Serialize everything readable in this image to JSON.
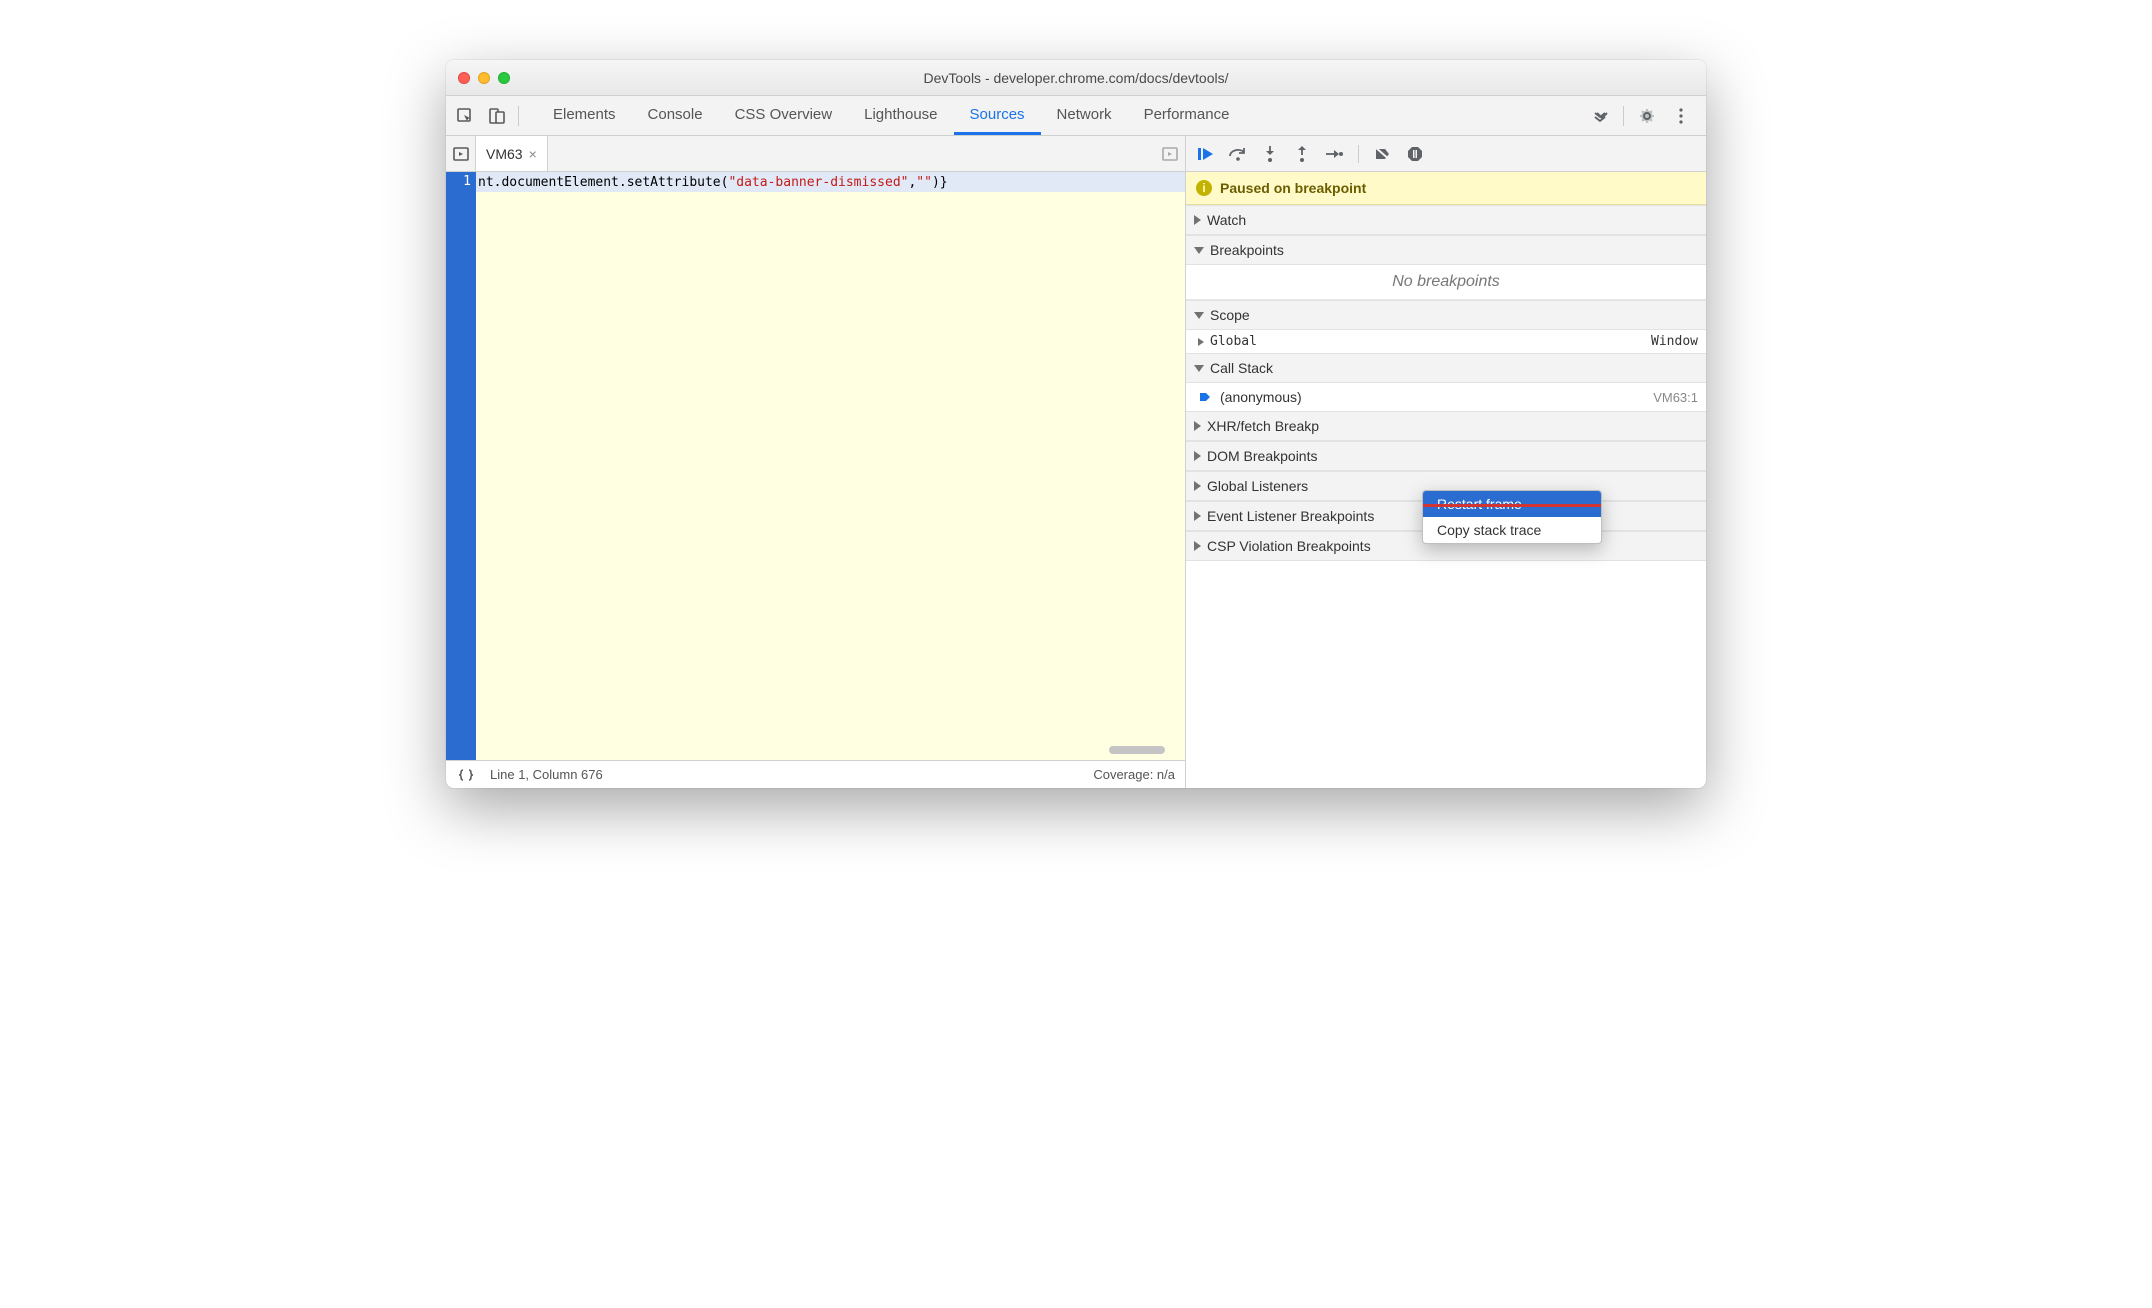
{
  "title": "DevTools - developer.chrome.com/docs/devtools/",
  "tabs": [
    "Elements",
    "Console",
    "CSS Overview",
    "Lighthouse",
    "Sources",
    "Network",
    "Performance"
  ],
  "activeTab": "Sources",
  "fileTab": {
    "name": "VM63"
  },
  "code": {
    "lineNumber": "1",
    "part_a": "nt.documentElement.setAttribute(",
    "part_b": "\"data-banner-dismissed\"",
    "part_c": ",",
    "part_d": "\"\"",
    "part_e": ")}"
  },
  "statusBar": {
    "position": "Line 1, Column 676",
    "coverage": "Coverage: n/a"
  },
  "pausedBanner": "Paused on breakpoint",
  "sections": {
    "watch": "Watch",
    "breakpoints": "Breakpoints",
    "noBreakpoints": "No breakpoints",
    "scope": "Scope",
    "scopeGlobal": "Global",
    "scopeGlobalValue": "Window",
    "callStack": "Call Stack",
    "callStackFrame": "(anonymous)",
    "callStackLoc": "VM63:1",
    "xhr": "XHR/fetch Breakp",
    "dom": "DOM Breakpoints",
    "globalListeners": "Global Listeners",
    "eventListener": "Event Listener Breakpoints",
    "csp": "CSP Violation Breakpoints"
  },
  "contextMenu": {
    "restartFrame": "Restart frame",
    "copyStackTrace": "Copy stack trace"
  }
}
